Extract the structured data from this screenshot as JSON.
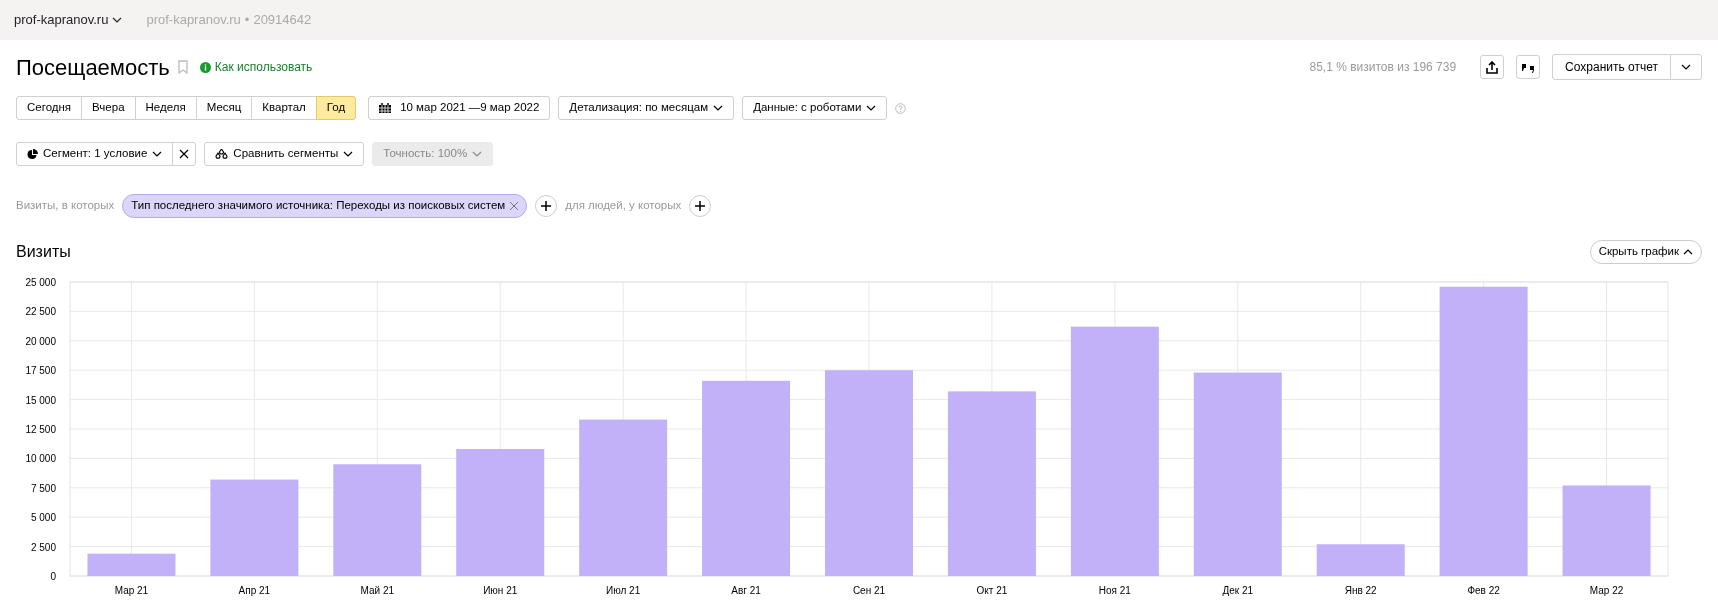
{
  "header": {
    "site_selector": "prof-kapranov.ru",
    "site_name": "prof-kapranov.ru",
    "separator": "•",
    "counter_id": "20914642"
  },
  "report": {
    "title": "Посещаемость",
    "help_link": "Как использовать",
    "summary": "85,1 % визитов из 196 739",
    "save_button": "Сохранить отчет"
  },
  "periods": [
    {
      "label": "Сегодня",
      "selected": false
    },
    {
      "label": "Вчера",
      "selected": false
    },
    {
      "label": "Неделя",
      "selected": false
    },
    {
      "label": "Месяц",
      "selected": false
    },
    {
      "label": "Квартал",
      "selected": false
    },
    {
      "label": "Год",
      "selected": true
    }
  ],
  "date_range": "10 мар 2021 —9 мар 2022",
  "dropdowns": [
    {
      "label": "Детализация: по месяцам"
    },
    {
      "label": "Данные: с роботами"
    }
  ],
  "segment": {
    "label": "Сегмент: 1 условие",
    "compare": "Сравнить сегменты",
    "accuracy": "Точность: 100%",
    "accuracy_disabled": true
  },
  "filter": {
    "prefix": "Визиты, в которых",
    "tag": "Тип последнего значимого источника: Переходы из поисковых систем",
    "people_label": "для людей, у которых"
  },
  "chart_section": {
    "title": "Визиты",
    "hide_button": "Скрыть график",
    "chart_data": {
      "type": "bar",
      "categories": [
        "Мар 21",
        "Апр 21",
        "Май 21",
        "Июн 21",
        "Июл 21",
        "Авг 21",
        "Сен 21",
        "Окт 21",
        "Ноя 21",
        "Дек 21",
        "Янв 22",
        "Фев 22",
        "Мар 22"
      ],
      "grid": true,
      "series": [
        {
          "color": "#c2b1f9",
          "values": [
            1900,
            8200,
            9500,
            10800,
            13300,
            16600,
            17500,
            15700,
            21200,
            17300,
            2700,
            24600,
            7700
          ]
        }
      ],
      "ylim": [
        0,
        25000
      ],
      "yticks": [
        {
          "value": 0,
          "label": "0"
        },
        {
          "value": 2500,
          "label": "2 500"
        },
        {
          "value": 5000,
          "label": "5 000"
        },
        {
          "value": 7500,
          "label": "7 500"
        },
        {
          "value": 10000,
          "label": "10 000"
        },
        {
          "value": 12500,
          "label": "12 500"
        },
        {
          "value": 15000,
          "label": "15 000"
        },
        {
          "value": 17500,
          "label": "17 500"
        },
        {
          "value": 20000,
          "label": "20 000"
        },
        {
          "value": 22500,
          "label": "22 500"
        },
        {
          "value": 25000,
          "label": "25 000"
        }
      ]
    }
  }
}
